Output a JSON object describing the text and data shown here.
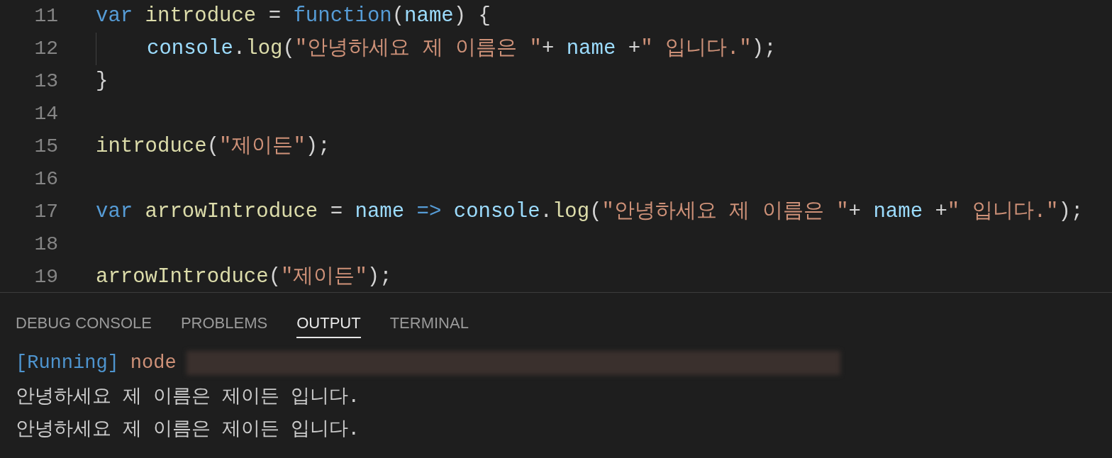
{
  "editor": {
    "lines": [
      {
        "number": "11",
        "tokens": [
          {
            "kind": "keyword",
            "text": "var"
          },
          {
            "kind": "function",
            "text": " introduce"
          },
          {
            "kind": "plain",
            "text": " = "
          },
          {
            "kind": "keyword",
            "text": "function"
          },
          {
            "kind": "plain",
            "text": "("
          },
          {
            "kind": "variable",
            "text": "name"
          },
          {
            "kind": "plain",
            "text": ") {"
          }
        ]
      },
      {
        "number": "12",
        "indented": true,
        "tokens": [
          {
            "kind": "variable",
            "text": "console"
          },
          {
            "kind": "plain",
            "text": "."
          },
          {
            "kind": "function",
            "text": "log"
          },
          {
            "kind": "plain",
            "text": "("
          },
          {
            "kind": "string",
            "text": "\"안녕하세요 제 이름은 \""
          },
          {
            "kind": "plain",
            "text": "+ "
          },
          {
            "kind": "variable",
            "text": "name"
          },
          {
            "kind": "plain",
            "text": " +"
          },
          {
            "kind": "string",
            "text": "\" 입니다.\""
          },
          {
            "kind": "plain",
            "text": ");"
          }
        ]
      },
      {
        "number": "13",
        "tokens": [
          {
            "kind": "plain",
            "text": "}"
          }
        ]
      },
      {
        "number": "14"
      },
      {
        "number": "15",
        "tokens": [
          {
            "kind": "function",
            "text": "introduce"
          },
          {
            "kind": "plain",
            "text": "("
          },
          {
            "kind": "string",
            "text": "\"제이든\""
          },
          {
            "kind": "plain",
            "text": ");"
          }
        ]
      },
      {
        "number": "16"
      },
      {
        "number": "17",
        "tokens": [
          {
            "kind": "keyword",
            "text": "var"
          },
          {
            "kind": "function",
            "text": " arrowIntroduce"
          },
          {
            "kind": "plain",
            "text": " = "
          },
          {
            "kind": "variable",
            "text": "name"
          },
          {
            "kind": "keyword",
            "text": " =>"
          },
          {
            "kind": "variable",
            "text": " console"
          },
          {
            "kind": "plain",
            "text": "."
          },
          {
            "kind": "function",
            "text": "log"
          },
          {
            "kind": "plain",
            "text": "("
          },
          {
            "kind": "string",
            "text": "\"안녕하세요 제 이름은 \""
          },
          {
            "kind": "plain",
            "text": "+ "
          },
          {
            "kind": "variable",
            "text": "name"
          },
          {
            "kind": "plain",
            "text": " +"
          },
          {
            "kind": "string",
            "text": "\" 입니다.\""
          },
          {
            "kind": "plain",
            "text": ");"
          }
        ]
      },
      {
        "number": "18"
      },
      {
        "number": "19",
        "tokens": [
          {
            "kind": "function",
            "text": "arrowIntroduce"
          },
          {
            "kind": "plain",
            "text": "("
          },
          {
            "kind": "string",
            "text": "\"제이든\""
          },
          {
            "kind": "plain",
            "text": ");"
          }
        ]
      }
    ]
  },
  "panel": {
    "tabs": [
      {
        "label": "DEBUG CONSOLE",
        "selected": false
      },
      {
        "label": "PROBLEMS",
        "selected": false
      },
      {
        "label": "OUTPUT",
        "selected": true
      },
      {
        "label": "TERMINAL",
        "selected": false
      }
    ],
    "output": {
      "status": "[Running]",
      "command": "node",
      "lines": [
        "안녕하세요 제 이름은 제이든 입니다.",
        "안녕하세요 제 이름은 제이든 입니다."
      ]
    }
  }
}
